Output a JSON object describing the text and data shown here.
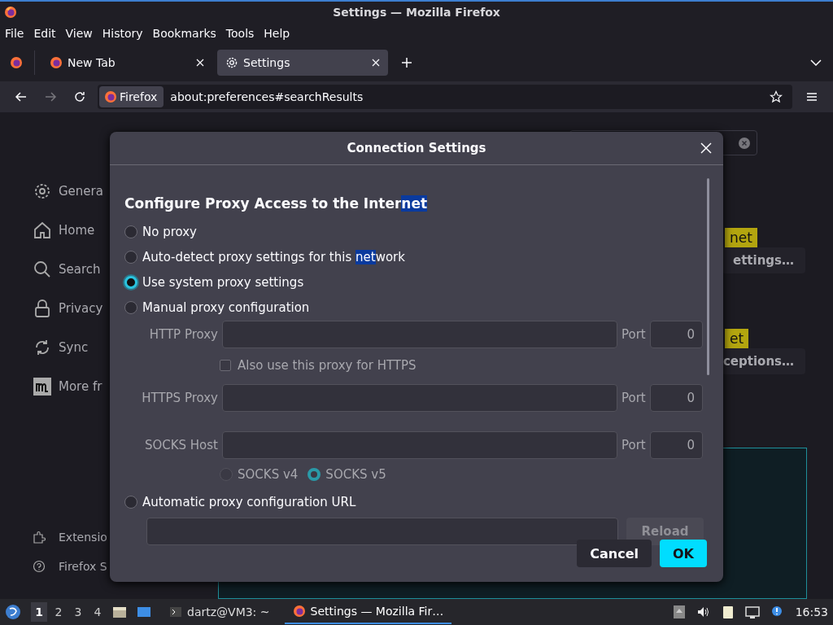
{
  "window": {
    "title": "Settings — Mozilla Firefox"
  },
  "menu": [
    "File",
    "Edit",
    "View",
    "History",
    "Bookmarks",
    "Tools",
    "Help"
  ],
  "tabs": [
    {
      "label": "New Tab",
      "kind": "firefox",
      "selected": false
    },
    {
      "label": "Settings",
      "kind": "settings",
      "selected": true
    }
  ],
  "address_bar": {
    "identity": "Firefox",
    "url": "about:preferences#searchResults"
  },
  "sidebar": {
    "items": [
      {
        "label": "Genera",
        "kind": "gear"
      },
      {
        "label": "Home",
        "kind": "home"
      },
      {
        "label": "Search",
        "kind": "search"
      },
      {
        "label": "Privacy",
        "kind": "lock"
      },
      {
        "label": "Sync",
        "kind": "sync"
      },
      {
        "label": "More fr",
        "kind": "m"
      }
    ],
    "footer": [
      {
        "label": "Extensio",
        "kind": "puzzle"
      },
      {
        "label": "Firefox S",
        "kind": "help"
      }
    ]
  },
  "background": {
    "tooltips": [
      "net",
      "et"
    ],
    "buttons": [
      "ettings…",
      "ceptions…"
    ]
  },
  "dialog": {
    "title": "Connection Settings",
    "heading": [
      "Configure Proxy Access to the Inter",
      "net"
    ],
    "options": [
      {
        "parts": [
          "No proxy"
        ],
        "selected": false
      },
      {
        "parts": [
          "Auto-detect proxy settings for this ",
          "net",
          "work"
        ],
        "selected": false
      },
      {
        "parts": [
          "Use system proxy settings"
        ],
        "selected": true
      },
      {
        "parts": [
          "Manual proxy configuration"
        ],
        "selected": false
      }
    ],
    "manual": {
      "disabled": true,
      "fields": [
        {
          "label": "HTTP Proxy",
          "port_label": "Port",
          "port": "0"
        },
        {
          "label": "HTTPS Proxy",
          "port_label": "Port",
          "port": "0"
        },
        {
          "label": "SOCKS Host",
          "port_label": "Port",
          "port": "0"
        }
      ],
      "also_https": {
        "label": "Also use this proxy for HTTPS",
        "checked": false
      },
      "socks": [
        {
          "label": "SOCKS v4",
          "selected": false
        },
        {
          "label": "SOCKS v5",
          "selected": true
        }
      ]
    },
    "auto_url": {
      "label": "Automatic proxy configuration URL",
      "selected": false,
      "reload": "Reload",
      "reload_disabled": true
    },
    "buttons": [
      {
        "label": "Cancel",
        "kind": "secondary"
      },
      {
        "label": "OK",
        "kind": "primary"
      }
    ]
  },
  "taskbar": {
    "workspaces": [
      {
        "label": "1",
        "selected": true
      },
      {
        "label": "2",
        "selected": false
      },
      {
        "label": "3",
        "selected": false
      },
      {
        "label": "4",
        "selected": false
      }
    ],
    "tasks": [
      {
        "label": "dartz@VM3: ~",
        "kind": "terminal",
        "selected": false
      },
      {
        "label": "Settings — Mozilla Fir…",
        "kind": "firefox",
        "selected": true
      }
    ],
    "clock": "16:53"
  }
}
